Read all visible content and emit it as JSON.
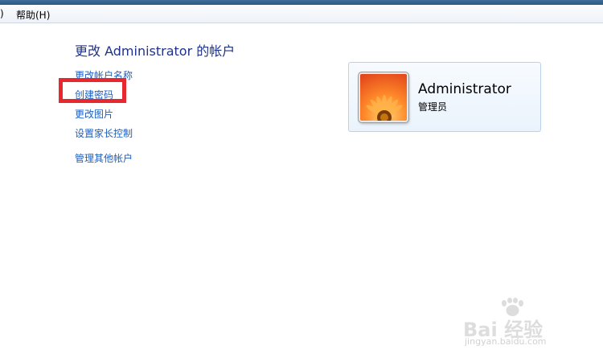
{
  "menu": {
    "prev_item_tail": ")",
    "help": "帮助(H)"
  },
  "title": "更改 Administrator 的帐户",
  "tasks": [
    {
      "label": "更改帐户名称"
    },
    {
      "label": "创建密码"
    },
    {
      "label": "更改图片"
    },
    {
      "label": "设置家长控制"
    },
    {
      "label": "管理其他帐户"
    }
  ],
  "account": {
    "name": "Administrator",
    "role": "管理员",
    "picture_icon": "flower-icon"
  },
  "watermark": {
    "text": "Bai 经验",
    "url": "jingyan.baidu.com"
  },
  "colors": {
    "link": "#1d5fc0",
    "title": "#1e3287",
    "highlight": "#e8282f",
    "card_border": "#bcd2ea"
  }
}
